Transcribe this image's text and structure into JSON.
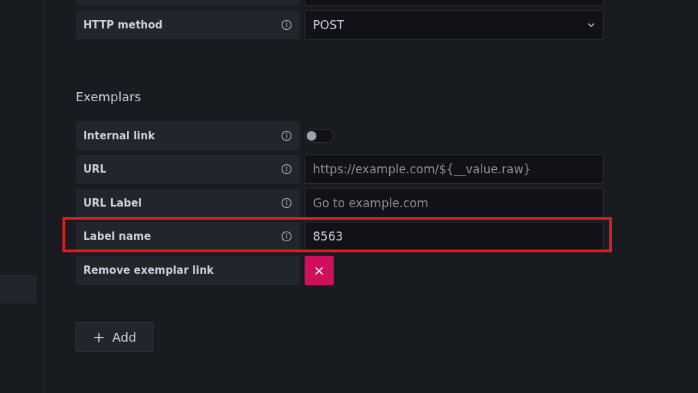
{
  "sidebar": {
    "items": [
      {
        "selected": true
      }
    ]
  },
  "settings": [
    {
      "kind": "select",
      "label": "HTTP method",
      "value": "POST"
    }
  ],
  "exemplars": {
    "title": "Exemplars",
    "fields": [
      {
        "kind": "toggle",
        "label": "Internal link",
        "on": false
      },
      {
        "kind": "text",
        "label": "URL",
        "placeholder": "https://example.com/${__value.raw}"
      },
      {
        "kind": "text",
        "label": "URL Label",
        "placeholder": "Go to example.com"
      },
      {
        "kind": "text",
        "label": "Label name",
        "value": "8563",
        "highlighted": true
      },
      {
        "kind": "remove",
        "label": "Remove exemplar link",
        "button": "×"
      }
    ]
  },
  "add_button": {
    "icon": "+",
    "label": "Add"
  }
}
